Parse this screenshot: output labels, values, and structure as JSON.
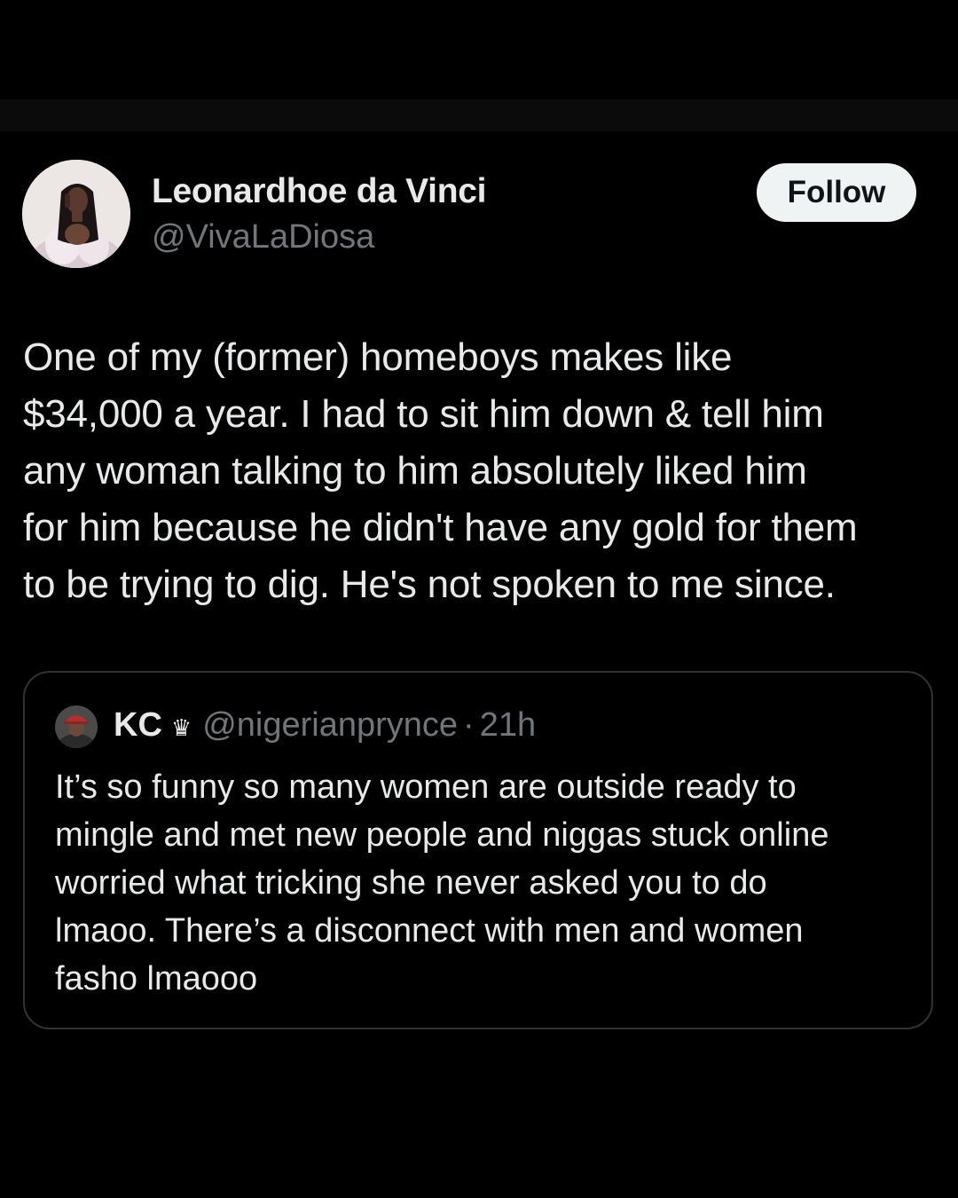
{
  "colors": {
    "background": "#000000",
    "text_primary": "#e7e9ea",
    "text_secondary": "#71767b",
    "follow_button_bg": "#eff3f4",
    "follow_button_text": "#0f1419",
    "card_border": "#2f3336"
  },
  "tweet": {
    "author": {
      "name": "Leonardhoe da Vinci",
      "handle": "@VivaLaDiosa",
      "avatar_icon": "profile-photo"
    },
    "follow_label": "Follow",
    "text": "One of my (former) homeboys makes like\n$34,000 a year. I had to sit him down & tell him\nany woman talking to him absolutely liked him\nfor him because he didn't have any gold for them\nto be trying to dig. He's not spoken to me since."
  },
  "quoted_tweet": {
    "author": {
      "name": "KC",
      "badge_icon": "crown-icon",
      "badge_glyph": "♛",
      "handle": "@nigerianprynce",
      "avatar_icon": "profile-photo"
    },
    "separator": "·",
    "time": "21h",
    "text": "It’s so funny so many women are outside ready to\nmingle and met new people and niggas stuck online\nworried what tricking she never asked you to do\nlmaoo. There’s a disconnect with men and women\nfasho lmaooo"
  }
}
